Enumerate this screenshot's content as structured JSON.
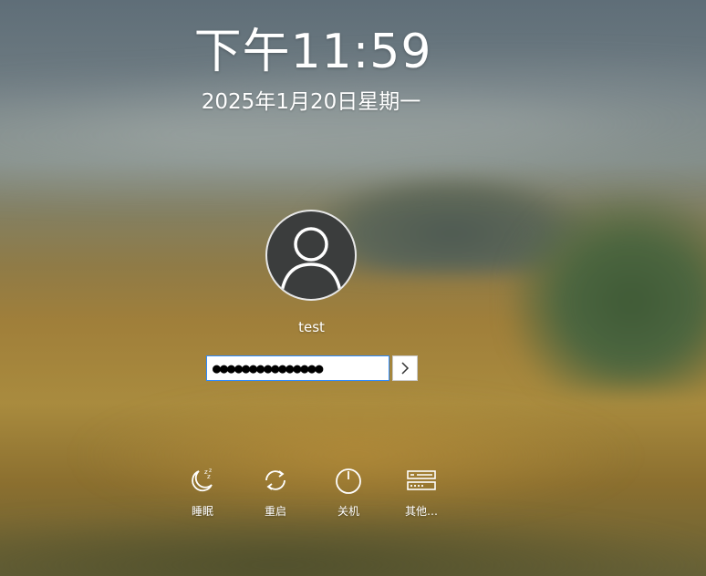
{
  "clock": {
    "time": "下午11:59",
    "date": "2025年1月20日星期一"
  },
  "user": {
    "name": "test",
    "avatar_icon": "user-avatar-icon"
  },
  "login": {
    "password_value": "●●●●●●●●●●●●●●●",
    "submit_icon": "chevron-right-icon",
    "accent_color": "#2e8bff"
  },
  "actions": [
    {
      "label": "睡眠",
      "icon": "sleep-moon-icon"
    },
    {
      "label": "重启",
      "icon": "restart-icon"
    },
    {
      "label": "关机",
      "icon": "power-icon"
    },
    {
      "label": "其他…",
      "icon": "other-options-icon"
    }
  ]
}
